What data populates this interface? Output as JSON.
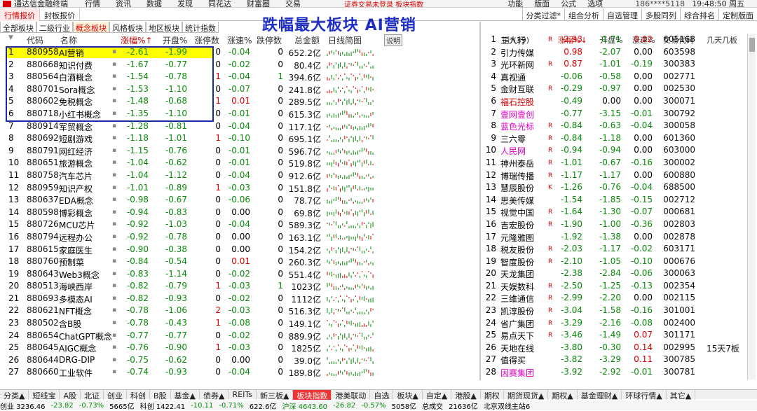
{
  "app": {
    "name": "通达信金融终端",
    "menus": [
      "行情",
      "资讯",
      "数据",
      "发现",
      "同花达",
      "财富圈",
      "交易"
    ],
    "promo": "证券交易未登录 板块指数",
    "right_menus": [
      "功能",
      "版面",
      "公式",
      "选项"
    ],
    "user": "186****5118",
    "clock": "19:48:50 周五"
  },
  "toolbar": {
    "tabs": [
      "行情报价",
      "封板报价"
    ],
    "active_tab": "行情报价",
    "right_buttons": [
      "分类过滤*",
      "组合分析",
      "自选管理",
      "多股同列",
      "综合排名",
      "定制版面"
    ]
  },
  "subtabs": {
    "items": [
      "全部板块",
      "二级行业",
      "概念板块",
      "风格板块",
      "地区板块",
      "统计指数"
    ],
    "active": "概念板块"
  },
  "banner": "跌幅最大板块 AI营销",
  "left_table": {
    "columns": [
      "代码",
      "名称",
      "涨幅%↑",
      "开盘%",
      "涨停数",
      "涨速%",
      "跌停数",
      "总金额",
      "日线简图"
    ],
    "note": "说明",
    "rows": [
      {
        "i": "1",
        "code": "880958",
        "name": "AI营销",
        "chg": "-2.61",
        "open": "-1.99",
        "lu": "0",
        "spd": "-0.04",
        "ld": "0",
        "amt": "652.2亿"
      },
      {
        "i": "2",
        "code": "880668",
        "name": "知识付费",
        "chg": "-1.67",
        "open": "-0.77",
        "lu": "0",
        "spd": "-0.02",
        "ld": "0",
        "amt": "80.4亿"
      },
      {
        "i": "3",
        "code": "880564",
        "name": "白酒概念",
        "chg": "-1.54",
        "open": "-0.78",
        "lu": "1",
        "spd": "-0.04",
        "ld": "1",
        "amt": "394.6亿"
      },
      {
        "i": "4",
        "code": "880701",
        "name": "Sora概念",
        "chg": "-1.53",
        "open": "-1.10",
        "lu": "0",
        "spd": "-0.07",
        "ld": "0",
        "amt": "241.8亿"
      },
      {
        "i": "5",
        "code": "880602",
        "name": "免税概念",
        "chg": "-1.48",
        "open": "-0.68",
        "lu": "1",
        "spd": "0.01",
        "ld": "0",
        "amt": "289.5亿"
      },
      {
        "i": "6",
        "code": "880718",
        "name": "小红书概念",
        "chg": "-1.35",
        "open": "-1.10",
        "lu": "0",
        "spd": "-0.01",
        "ld": "0",
        "amt": "615.3亿"
      },
      {
        "i": "7",
        "code": "880914",
        "name": "军贸概念",
        "chg": "-1.28",
        "open": "-0.81",
        "lu": "0",
        "spd": "-0.04",
        "ld": "0",
        "amt": "117.1亿"
      },
      {
        "i": "8",
        "code": "880692",
        "name": "短剧游戏",
        "chg": "-1.18",
        "open": "-1.01",
        "lu": "1",
        "spd": "-0.10",
        "ld": "0",
        "amt": "695.1亿"
      },
      {
        "i": "9",
        "code": "880791",
        "name": "网红经济",
        "chg": "-1.15",
        "open": "-0.76",
        "lu": "0",
        "spd": "-0.01",
        "ld": "0",
        "amt": "596.7亿"
      },
      {
        "i": "10",
        "code": "880651",
        "name": "旅游概念",
        "chg": "-1.04",
        "open": "-0.62",
        "lu": "0",
        "spd": "-0.01",
        "ld": "0",
        "amt": "519.8亿"
      },
      {
        "i": "11",
        "code": "880758",
        "name": "汽车芯片",
        "chg": "-1.04",
        "open": "-1.12",
        "lu": "0",
        "spd": "-0.04",
        "ld": "0",
        "amt": "912.6亿"
      },
      {
        "i": "12",
        "code": "880959",
        "name": "知识产权",
        "chg": "-1.01",
        "open": "-0.89",
        "lu": "1",
        "spd": "-0.03",
        "ld": "0",
        "amt": "151.8亿"
      },
      {
        "i": "13",
        "code": "880637",
        "name": "EDA概念",
        "chg": "-0.98",
        "open": "-0.67",
        "lu": "0",
        "spd": "-0.06",
        "ld": "0",
        "amt": "78.7亿"
      },
      {
        "i": "14",
        "code": "880598",
        "name": "博彩概念",
        "chg": "-0.94",
        "open": "-0.83",
        "lu": "0",
        "spd": "0.00",
        "ld": "0",
        "amt": "69.8亿"
      },
      {
        "i": "15",
        "code": "880726",
        "name": "MCU芯片",
        "chg": "-0.92",
        "open": "-1.03",
        "lu": "0",
        "spd": "-0.04",
        "ld": "0",
        "amt": "589.3亿"
      },
      {
        "i": "16",
        "code": "880794",
        "name": "远程办公",
        "chg": "-0.92",
        "open": "-0.78",
        "lu": "0",
        "spd": "0.00",
        "ld": "0",
        "amt": "163.1亿"
      },
      {
        "i": "17",
        "code": "880615",
        "name": "家庭医生",
        "chg": "-0.90",
        "open": "-0.38",
        "lu": "0",
        "spd": "0.00",
        "ld": "0",
        "amt": "154.2亿"
      },
      {
        "i": "18",
        "code": "880760",
        "name": "预制菜",
        "chg": "-0.84",
        "open": "-0.54",
        "lu": "0",
        "spd": "0.01",
        "ld": "0",
        "amt": "260.3亿"
      },
      {
        "i": "19",
        "code": "880643",
        "name": "Web3概念",
        "chg": "-0.83",
        "open": "-1.14",
        "lu": "0",
        "spd": "-0.02",
        "ld": "0",
        "amt": "551.4亿"
      },
      {
        "i": "20",
        "code": "880513",
        "name": "海峡西岸",
        "chg": "-0.82",
        "open": "-0.79",
        "lu": "1",
        "spd": "-0.03",
        "ld": "1",
        "amt": "1023亿"
      },
      {
        "i": "21",
        "code": "880693",
        "name": "多模态AI",
        "chg": "-0.82",
        "open": "-0.93",
        "lu": "0",
        "spd": "-0.02",
        "ld": "0",
        "amt": "1112亿"
      },
      {
        "i": "22",
        "code": "880621",
        "name": "NFT概念",
        "chg": "-0.78",
        "open": "-1.06",
        "lu": "2",
        "spd": "-0.03",
        "ld": "0",
        "amt": "516.3亿"
      },
      {
        "i": "23",
        "code": "880502",
        "name": "含B股",
        "chg": "-0.78",
        "open": "-0.43",
        "lu": "1",
        "spd": "-0.08",
        "ld": "0",
        "amt": "149.1亿"
      },
      {
        "i": "24",
        "code": "880654",
        "name": "ChatGPT概念",
        "chg": "-0.77",
        "open": "-0.77",
        "lu": "0",
        "spd": "-0.02",
        "ld": "0",
        "amt": "889.9亿"
      },
      {
        "i": "25",
        "code": "880645",
        "name": "AIGC概念",
        "chg": "-0.76",
        "open": "-0.90",
        "lu": "1",
        "spd": "-0.03",
        "ld": "0",
        "amt": "1825亿"
      },
      {
        "i": "26",
        "code": "880644",
        "name": "DRG-DIP",
        "chg": "-0.75",
        "open": "-0.62",
        "lu": "0",
        "spd": "0.00",
        "ld": "0",
        "amt": "39.0亿"
      },
      {
        "i": "27",
        "code": "880660",
        "name": "工业软件",
        "chg": "-0.74",
        "open": "-0.93",
        "lu": "0",
        "spd": "-0.04",
        "ld": "0",
        "amt": "189.8亿"
      }
    ]
  },
  "right_table": {
    "title": "销*(39)",
    "columns": [
      "涨幅%↓",
      "开盘%",
      "涨速%",
      "交易代码",
      "几天几板"
    ],
    "rows": [
      {
        "i": "1",
        "name": "三人行",
        "flag": "R",
        "chg": "2.93",
        "open": "-1.71",
        "spd": "0.02",
        "code": "605168",
        "x": "",
        "cc": "red",
        "oc": "grn",
        "sc": "red",
        "nc": "blk"
      },
      {
        "i": "2",
        "name": "引力传媒",
        "flag": "",
        "chg": "0.98",
        "open": "-2.07",
        "spd": "0.00",
        "code": "603598",
        "x": "",
        "cc": "red",
        "oc": "grn",
        "sc": "blk",
        "nc": "blk"
      },
      {
        "i": "3",
        "name": "光环新网",
        "flag": "R",
        "chg": "0.87",
        "open": "-1.01",
        "spd": "-0.19",
        "code": "300383",
        "x": "",
        "cc": "red",
        "oc": "grn",
        "sc": "grn",
        "nc": "blk"
      },
      {
        "i": "4",
        "name": "真视通",
        "flag": "",
        "chg": "-0.06",
        "open": "-0.58",
        "spd": "0.00",
        "code": "002771",
        "x": "",
        "cc": "grn",
        "oc": "grn",
        "sc": "blk",
        "nc": "blk"
      },
      {
        "i": "5",
        "name": "金财互联",
        "flag": "R",
        "chg": "-0.29",
        "open": "-0.97",
        "spd": "0.00",
        "code": "002530",
        "x": "",
        "cc": "grn",
        "oc": "grn",
        "sc": "blk",
        "nc": "blk"
      },
      {
        "i": "6",
        "name": "福石控股",
        "flag": "",
        "chg": "-0.49",
        "open": "0.00",
        "spd": "0.00",
        "code": "300071",
        "x": "",
        "cc": "grn",
        "oc": "blk",
        "sc": "blk",
        "nc": "red"
      },
      {
        "i": "7",
        "name": "壹网壹创",
        "flag": "",
        "chg": "-0.77",
        "open": "-3.15",
        "spd": "-0.01",
        "code": "300792",
        "x": "",
        "cc": "grn",
        "oc": "grn",
        "sc": "grn",
        "nc": "pink"
      },
      {
        "i": "8",
        "name": "蓝色光标",
        "flag": "R",
        "chg": "-0.84",
        "open": "-0.63",
        "spd": "-0.04",
        "code": "300058",
        "x": "",
        "cc": "grn",
        "oc": "grn",
        "sc": "grn",
        "nc": "pink"
      },
      {
        "i": "9",
        "name": "三六零",
        "flag": "R",
        "chg": "-0.84",
        "open": "-1.18",
        "spd": "0.00",
        "code": "601360",
        "x": "",
        "cc": "grn",
        "oc": "grn",
        "sc": "blk",
        "nc": "blk"
      },
      {
        "i": "10",
        "name": "人民网",
        "flag": "R",
        "chg": "-0.94",
        "open": "-0.94",
        "spd": "0.00",
        "code": "603000",
        "x": "",
        "cc": "grn",
        "oc": "grn",
        "sc": "blk",
        "nc": "pink"
      },
      {
        "i": "11",
        "name": "神州泰岳",
        "flag": "R",
        "chg": "-1.01",
        "open": "-0.67",
        "spd": "-0.16",
        "code": "300002",
        "x": "",
        "cc": "grn",
        "oc": "grn",
        "sc": "grn",
        "nc": "blk"
      },
      {
        "i": "12",
        "name": "博瑞传播",
        "flag": "R",
        "chg": "-1.17",
        "open": "-1.17",
        "spd": "0.00",
        "code": "600880",
        "x": "",
        "cc": "grn",
        "oc": "grn",
        "sc": "blk",
        "nc": "blk"
      },
      {
        "i": "13",
        "name": "慧辰股份",
        "flag": "K",
        "chg": "-1.26",
        "open": "-0.76",
        "spd": "-0.04",
        "code": "688500",
        "x": "",
        "cc": "grn",
        "oc": "grn",
        "sc": "grn",
        "nc": "blk"
      },
      {
        "i": "14",
        "name": "思美传媒",
        "flag": "",
        "chg": "-1.54",
        "open": "-1.85",
        "spd": "-0.15",
        "code": "002712",
        "x": "",
        "cc": "grn",
        "oc": "grn",
        "sc": "grn",
        "nc": "blk"
      },
      {
        "i": "15",
        "name": "视觉中国",
        "flag": "R",
        "chg": "-1.64",
        "open": "-1.30",
        "spd": "-0.07",
        "code": "000681",
        "x": "",
        "cc": "grn",
        "oc": "grn",
        "sc": "grn",
        "nc": "blk"
      },
      {
        "i": "16",
        "name": "吉宏股份",
        "flag": "R",
        "chg": "-1.90",
        "open": "-1.00",
        "spd": "-0.36",
        "code": "002803",
        "x": "",
        "cc": "grn",
        "oc": "grn",
        "sc": "grn",
        "nc": "blk"
      },
      {
        "i": "17",
        "name": "元隆雅图",
        "flag": "",
        "chg": "-1.92",
        "open": "-1.38",
        "spd": "0.00",
        "code": "002878",
        "x": "",
        "cc": "grn",
        "oc": "grn",
        "sc": "blk",
        "nc": "blk"
      },
      {
        "i": "18",
        "name": "税友股份",
        "flag": "R",
        "chg": "-2.03",
        "open": "-1.17",
        "spd": "-0.02",
        "code": "603171",
        "x": "",
        "cc": "grn",
        "oc": "grn",
        "sc": "grn",
        "nc": "blk"
      },
      {
        "i": "19",
        "name": "智度股份",
        "flag": "R",
        "chg": "-2.10",
        "open": "-1.05",
        "spd": "-0.10",
        "code": "000676",
        "x": "",
        "cc": "grn",
        "oc": "grn",
        "sc": "grn",
        "nc": "blk"
      },
      {
        "i": "20",
        "name": "天龙集团",
        "flag": "",
        "chg": "-2.38",
        "open": "-2.84",
        "spd": "-0.06",
        "code": "300063",
        "x": "",
        "cc": "grn",
        "oc": "grn",
        "sc": "grn",
        "nc": "blk"
      },
      {
        "i": "21",
        "name": "天娱数科",
        "flag": "R",
        "chg": "-2.50",
        "open": "-1.25",
        "spd": "-0.13",
        "code": "002354",
        "x": "",
        "cc": "grn",
        "oc": "grn",
        "sc": "grn",
        "nc": "blk"
      },
      {
        "i": "22",
        "name": "三维通信",
        "flag": "R",
        "chg": "-2.99",
        "open": "-2.20",
        "spd": "0.00",
        "code": "002115",
        "x": "",
        "cc": "grn",
        "oc": "grn",
        "sc": "blk",
        "nc": "blk"
      },
      {
        "i": "23",
        "name": "凯淳股份",
        "flag": "R",
        "chg": "-3.04",
        "open": "-1.58",
        "spd": "-0.16",
        "code": "301001",
        "x": "",
        "cc": "grn",
        "oc": "grn",
        "sc": "grn",
        "nc": "blk"
      },
      {
        "i": "24",
        "name": "省广集团",
        "flag": "R",
        "chg": "-3.29",
        "open": "-2.16",
        "spd": "-0.08",
        "code": "002400",
        "x": "",
        "cc": "grn",
        "oc": "grn",
        "sc": "grn",
        "nc": "blk"
      },
      {
        "i": "25",
        "name": "易点天下",
        "flag": "R",
        "chg": "-3.46",
        "open": "-1.49",
        "spd": "0.07",
        "code": "301171",
        "x": "",
        "cc": "grn",
        "oc": "grn",
        "sc": "red",
        "nc": "blk"
      },
      {
        "i": "26",
        "name": "天地在线",
        "flag": "",
        "chg": "-3.80",
        "open": "-0.30",
        "spd": "0.14",
        "code": "002995",
        "x": "15天7板",
        "cc": "grn",
        "oc": "grn",
        "sc": "red",
        "nc": "blk"
      },
      {
        "i": "27",
        "name": "值得买",
        "flag": "",
        "chg": "-3.82",
        "open": "-3.29",
        "spd": "0.11",
        "code": "300785",
        "x": "",
        "cc": "grn",
        "oc": "grn",
        "sc": "red",
        "nc": "blk"
      },
      {
        "i": "28",
        "name": "因赛集团",
        "flag": "",
        "chg": "-3.92",
        "open": "-2.92",
        "spd": "-0.01",
        "code": "300781",
        "x": "",
        "cc": "grn",
        "oc": "grn",
        "sc": "grn",
        "nc": "pink"
      }
    ]
  },
  "bottom_tabs": [
    "分类▲",
    "短线宝",
    "A股",
    "北证",
    "创业",
    "科创",
    "B股",
    "基金▲",
    "债券▲",
    "REITs",
    "新三板▲",
    "板块指数",
    "港美联动",
    "自选",
    "板块▲",
    "自定▲",
    "港股▲",
    "期权",
    "期货现货▲",
    "期权▲",
    "基金理财▲",
    "环球行情▲",
    "其它▲"
  ],
  "bottom_tab_active": "板块指数",
  "status": {
    "items": [
      {
        "t": "创业 3236.46",
        "c": "blk"
      },
      {
        "t": "-23.82",
        "c": "grn"
      },
      {
        "t": "-0.73%",
        "c": "grn"
      },
      {
        "t": "5665亿",
        "c": "blk"
      },
      {
        "t": "科创 1422.41",
        "c": "blk"
      },
      {
        "t": "-10.11",
        "c": "grn"
      },
      {
        "t": "-0.71%",
        "c": "grn"
      },
      {
        "t": "622.6亿",
        "c": "blk"
      },
      {
        "t": "沪深 4643.60",
        "c": "grn"
      },
      {
        "t": "-26.82",
        "c": "grn"
      },
      {
        "t": "-0.57%",
        "c": "grn"
      },
      {
        "t": "5058亿",
        "c": "blk"
      },
      {
        "t": "总成交",
        "c": "blk"
      },
      {
        "t": "21636亿",
        "c": "blk"
      },
      {
        "t": "北京双线主站6",
        "c": "blk"
      }
    ]
  },
  "colors": {
    "red": "#d00000",
    "green": "#0a8a0a",
    "banner": "#1f2fc4",
    "highlight": "#ffff00",
    "box": "#1a2ba8"
  }
}
